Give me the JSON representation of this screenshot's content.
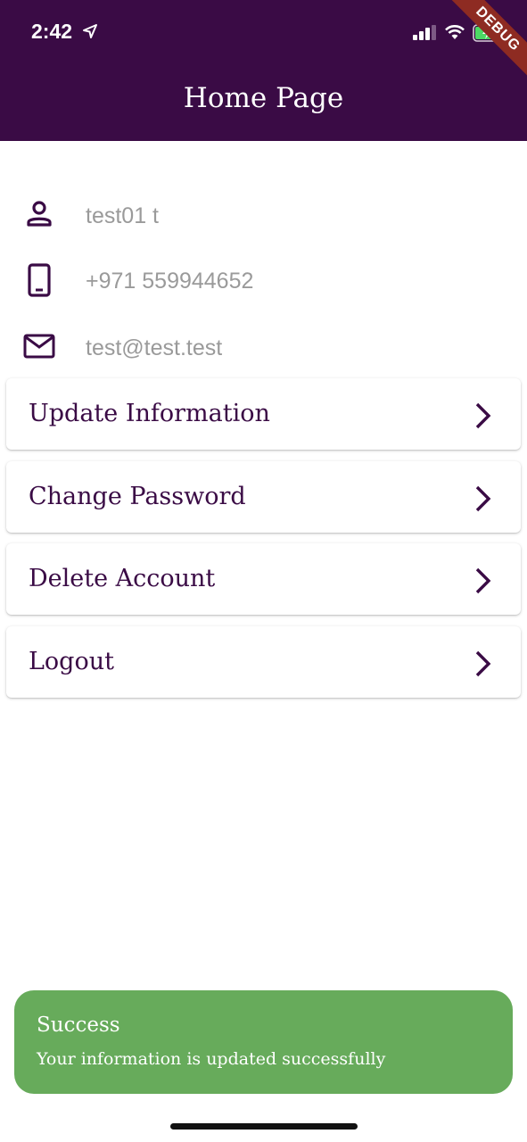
{
  "status_bar": {
    "time": "2:42",
    "icons": [
      "location-arrow-icon",
      "signal-icon",
      "wifi-icon",
      "battery-charging-icon"
    ]
  },
  "debug_banner": "DEBUG",
  "app_bar": {
    "title": "Home Page",
    "color": "#3a0b45"
  },
  "profile": {
    "name": "test01 t",
    "phone": "+971 559944652",
    "email": "test@test.test",
    "icons": [
      "person-icon",
      "phone-icon",
      "mail-icon"
    ]
  },
  "menu": [
    {
      "label": "Update Information",
      "icon": "chevron-right-icon"
    },
    {
      "label": "Change Password",
      "icon": "chevron-right-icon"
    },
    {
      "label": "Delete Account",
      "icon": "chevron-right-icon"
    },
    {
      "label": "Logout",
      "icon": "chevron-right-icon"
    }
  ],
  "snackbar": {
    "title": "Success",
    "message": "Your information is updated successfully",
    "color": "#67ab5b"
  }
}
